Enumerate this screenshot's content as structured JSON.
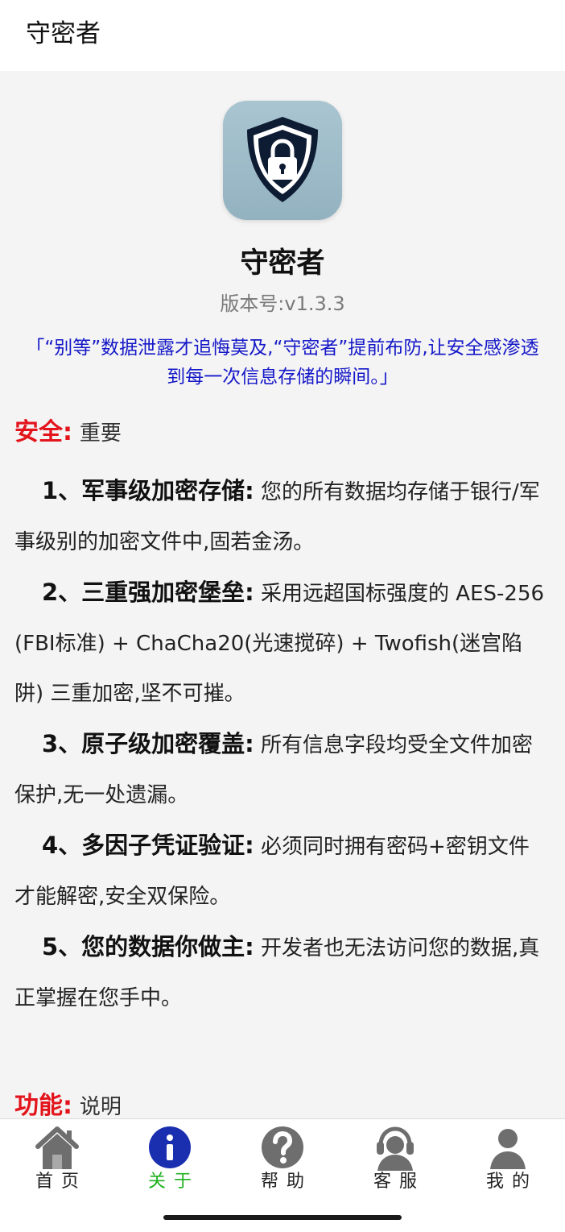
{
  "header": {
    "title": "守密者"
  },
  "about": {
    "app_name": "守密者",
    "version_label": "版本号:",
    "version_value": "v1.3.3",
    "slogan": "「“别等”数据泄露才追悔莫及,“守密者”提前布防,让安全感渗透到每一次信息存储的瞬间。」"
  },
  "security_section": {
    "key": "安全:",
    "value": "重要"
  },
  "features": [
    {
      "title": "1、军事级加密存储:",
      "desc": "您的所有数据均存储于银行/军事级别的加密文件中,固若金汤。"
    },
    {
      "title": "2、三重强加密堡垒:",
      "desc": "采用远超国标强度的 AES-256 (FBI标准) + ChaCha20(光速搅碎) + Twofish(迷宫陷阱) 三重加密,坚不可摧。"
    },
    {
      "title": "3、原子级加密覆盖:",
      "desc": "所有信息字段均受全文件加密保护,无一处遗漏。"
    },
    {
      "title": "4、多因子凭证验证:",
      "desc": "必须同时拥有密码+密钥文件才能解密,安全双保险。"
    },
    {
      "title": "5、您的数据你做主:",
      "desc": "开发者也无法访问您的数据,真正掌握在您手中。"
    }
  ],
  "function_section": {
    "key": "功能:",
    "value": "说明"
  },
  "tabs": [
    {
      "label": "首页",
      "icon": "home-icon",
      "active": false
    },
    {
      "label": "关于",
      "icon": "info-icon",
      "active": true
    },
    {
      "label": "帮助",
      "icon": "help-icon",
      "active": false
    },
    {
      "label": "客服",
      "icon": "headset-icon",
      "active": false
    },
    {
      "label": "我的",
      "icon": "user-icon",
      "active": false
    }
  ],
  "colors": {
    "accent_red": "#e3141c",
    "slogan_blue": "#1518c8",
    "active_tab_green": "#1fb11f",
    "active_tab_icon_blue": "#1a2fb0",
    "icon_navy": "#0d1b33"
  }
}
